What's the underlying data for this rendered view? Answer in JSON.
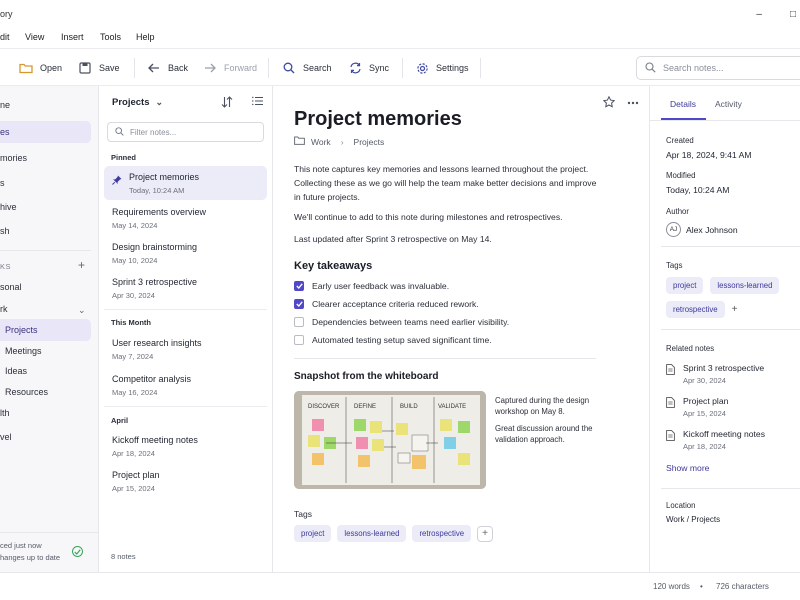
{
  "window": {
    "title": "ory",
    "minimize": "–",
    "maximize": "□"
  },
  "menu": [
    "dit",
    "View",
    "Insert",
    "Tools",
    "Help"
  ],
  "toolbar": {
    "open": "Open",
    "save": "Save",
    "back": "Back",
    "forward": "Forward",
    "search": "Search",
    "sync": "Sync",
    "settings": "Settings",
    "search_placeholder": "Search notes..."
  },
  "sidebar": {
    "items": [
      {
        "label": "ne"
      },
      {
        "label": "es",
        "active": true
      },
      {
        "label": "mories"
      },
      {
        "label": "s"
      },
      {
        "label": "hive"
      },
      {
        "label": "sh"
      }
    ],
    "notebooks_label": "KS",
    "notebooks": [
      {
        "label": "sonal"
      },
      {
        "label": "rk"
      },
      {
        "label": "Projects",
        "active": true
      },
      {
        "label": "Meetings"
      },
      {
        "label": "Ideas"
      },
      {
        "label": "Resources"
      },
      {
        "label": "lth"
      },
      {
        "label": "vel"
      }
    ],
    "sync_line1": "ced just now",
    "sync_line2": "hanges up to date"
  },
  "notes": {
    "header": "Projects",
    "filter_placeholder": "Filter notes...",
    "groups": [
      {
        "label": "Pinned",
        "items": [
          {
            "title": "Project memories",
            "date": "Today, 10:24 AM",
            "active": true
          },
          {
            "title": "Requirements overview",
            "date": "May 14, 2024"
          },
          {
            "title": "Design brainstorming",
            "date": "May 10, 2024"
          },
          {
            "title": "Sprint 3 retrospective",
            "date": "Apr 30, 2024"
          }
        ]
      },
      {
        "label": "This Month",
        "items": [
          {
            "title": "User research insights",
            "date": "May 7, 2024"
          },
          {
            "title": "Competitor analysis",
            "date": "May 16, 2024"
          }
        ]
      },
      {
        "label": "April",
        "items": [
          {
            "title": "Kickoff meeting notes",
            "date": "Apr 18, 2024"
          },
          {
            "title": "Project plan",
            "date": "Apr 15, 2024"
          }
        ]
      }
    ],
    "count": "8 notes"
  },
  "editor": {
    "title": "Project memories",
    "breadcrumb": [
      "Work",
      "Projects"
    ],
    "p1": "This note captures key memories and lessons learned throughout the project. Collecting these as we go will help the team make better decisions and improve in future projects.",
    "p2": "We'll continue to add to this note during milestones and retrospectives.",
    "p3": "Last updated after Sprint 3 retrospective on May 14.",
    "takeaways_heading": "Key takeaways",
    "takeaways": [
      {
        "text": "Early user feedback was invaluable.",
        "checked": true
      },
      {
        "text": "Clearer acceptance criteria reduced rework.",
        "checked": true
      },
      {
        "text": "Dependencies between teams need earlier visibility.",
        "checked": false
      },
      {
        "text": "Automated testing setup saved significant time.",
        "checked": false
      }
    ],
    "snapshot_heading": "Snapshot from the whiteboard",
    "whiteboard_columns": [
      "DISCOVER",
      "DEFINE",
      "BUILD",
      "VALIDATE"
    ],
    "caption1": "Captured during the design workshop on May 8.",
    "caption2": "Great discussion around the validation approach.",
    "tags_label": "Tags",
    "tags": [
      "project",
      "lessons-learned",
      "retrospective"
    ],
    "add_tag": "+"
  },
  "details": {
    "tabs": [
      "Details",
      "Activity"
    ],
    "created_label": "Created",
    "created": "Apr 18, 2024, 9:41 AM",
    "modified_label": "Modified",
    "modified": "Today, 10:24 AM",
    "author_label": "Author",
    "author_initials": "AJ",
    "author": "Alex Johnson",
    "tags_label": "Tags",
    "tags": [
      "project",
      "lessons-learned",
      "retrospective"
    ],
    "add_tag": "+",
    "related_label": "Related notes",
    "related": [
      {
        "title": "Sprint 3 retrospective",
        "date": "Apr 30, 2024"
      },
      {
        "title": "Project plan",
        "date": "Apr 15, 2024"
      },
      {
        "title": "Kickoff meeting notes",
        "date": "Apr 18, 2024"
      }
    ],
    "show_more": "Show more",
    "location_label": "Location",
    "location": "Work / Projects"
  },
  "status": {
    "words": "120 words",
    "sep": "•",
    "chars": "726 characters"
  },
  "colors": {
    "accent": "#5048c8",
    "accent_bg": "#ecebf8",
    "sync_ok": "#3aa55c"
  }
}
